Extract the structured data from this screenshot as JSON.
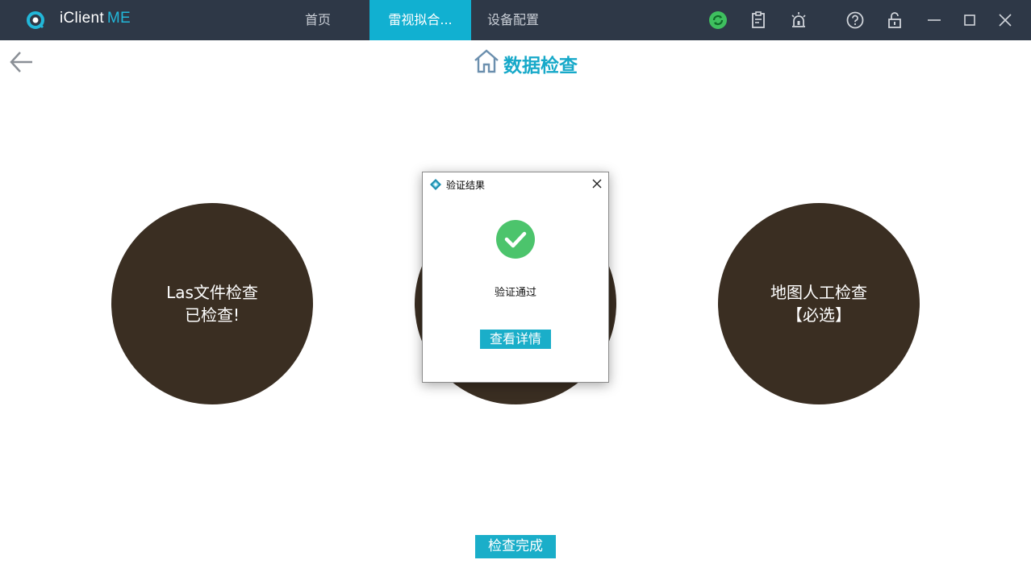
{
  "app": {
    "title_main": "iClient",
    "title_suffix": "ME"
  },
  "tabs": [
    {
      "label": "首页",
      "active": false
    },
    {
      "label": "雷视拟合...",
      "active": true
    },
    {
      "label": "设备配置",
      "active": false
    }
  ],
  "toolbar_icons": [
    "sync-icon",
    "clipboard-icon",
    "alarm-icon",
    "help-icon",
    "lock-icon",
    "minimize-icon",
    "maximize-icon",
    "close-icon"
  ],
  "page": {
    "title": "数据检查"
  },
  "circles": [
    {
      "line1": "Las文件检查",
      "line2": "已检查!"
    },
    {
      "line1": "",
      "line2": ""
    },
    {
      "line1": "地图人工检查",
      "line2": "【必选】"
    }
  ],
  "dialog": {
    "title": "验证结果",
    "message": "验证通过",
    "button_label": "查看详情"
  },
  "footer": {
    "button_label": "检查完成"
  },
  "colors": {
    "titlebar": "#2e3847",
    "accent": "#11b0d1",
    "circle": "#3a2e22",
    "success": "#4cc46c"
  }
}
